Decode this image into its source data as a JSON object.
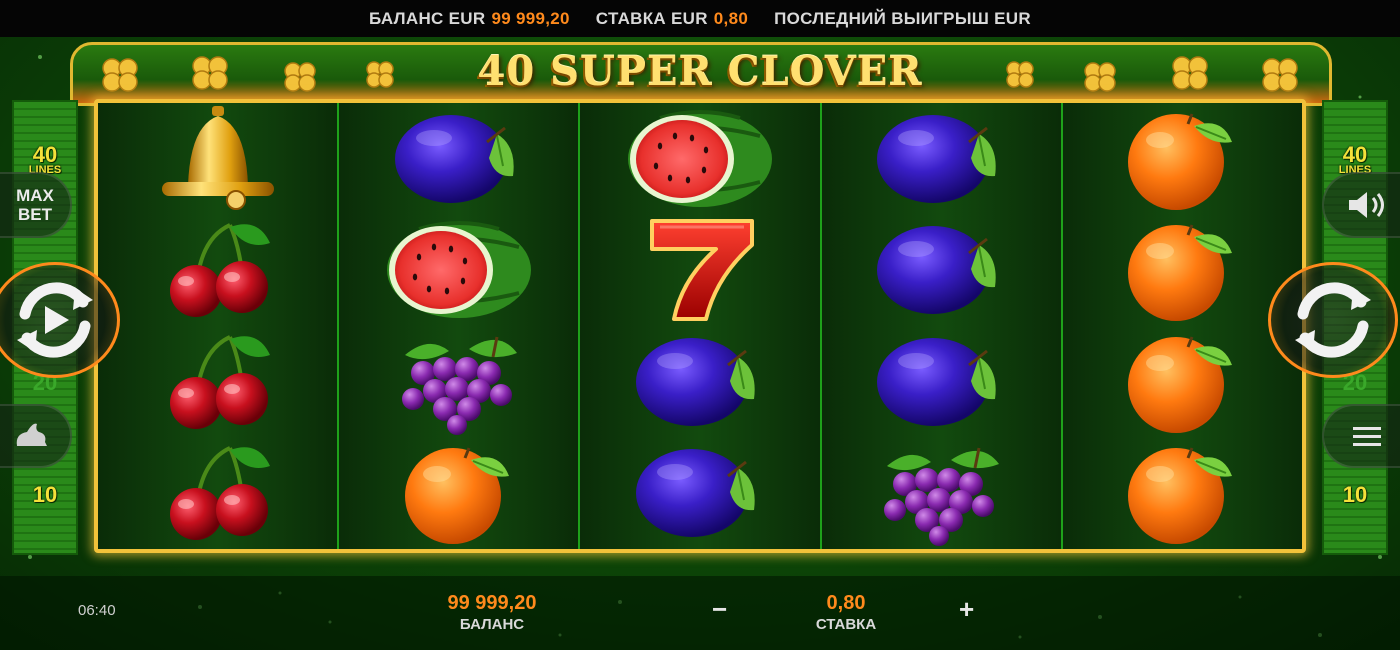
{
  "topbar": {
    "balance_label": "БАЛАНС EUR",
    "balance_value": "99 999,20",
    "bet_label": "СТАВКА EUR",
    "bet_value": "0,80",
    "last_win_label": "ПОСЛЕДНИЙ ВЫИГРЫШ EUR"
  },
  "title": "40 SUPER CLOVER",
  "lines": {
    "left_top": "40",
    "left_top_sub": "LINES",
    "right_top": "40",
    "right_top_sub": "LINES",
    "mid": "20",
    "bottom": "10"
  },
  "controls": {
    "max_bet_label_1": "MAX",
    "max_bet_label_2": "BET",
    "spin_left_icon": "spin-play-icon",
    "spin_right_icon": "spin-arrows-icon",
    "turbo_icon": "rabbit-icon",
    "sound_icon": "speaker-icon",
    "menu_icon": "hamburger-menu-icon"
  },
  "reels": [
    [
      "bell",
      "cherry",
      "cherry",
      "cherry"
    ],
    [
      "plum",
      "watermelon",
      "grapes",
      "orange"
    ],
    [
      "watermelon",
      "seven",
      "plum",
      "plum"
    ],
    [
      "plum",
      "plum",
      "plum",
      "grapes"
    ],
    [
      "orange",
      "orange",
      "orange",
      "orange"
    ]
  ],
  "bottombar": {
    "clock": "06:40",
    "balance_value": "99 999,20",
    "balance_label": "БАЛАНС",
    "bet_value": "0,80",
    "bet_label": "СТАВКА",
    "minus": "−",
    "plus": "+"
  },
  "colors": {
    "accent_orange": "#ff8a1c",
    "frame_gold": "#f2c23a",
    "reel_divider": "#1ea21a"
  }
}
